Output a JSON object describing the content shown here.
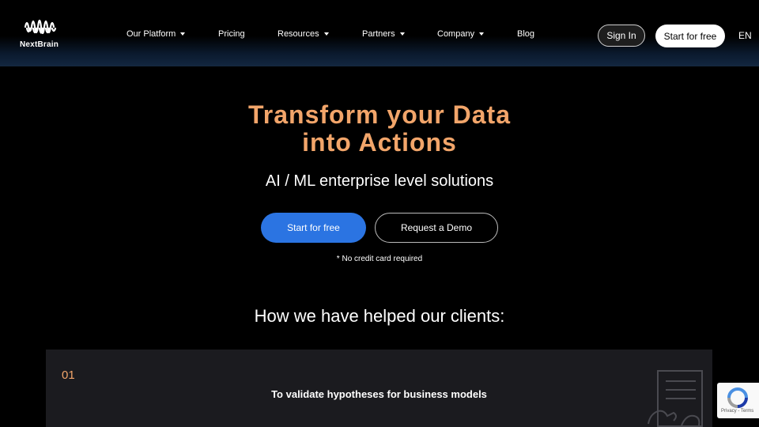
{
  "header": {
    "brand": "NextBrain",
    "nav": [
      {
        "label": "Our Platform",
        "dropdown": true
      },
      {
        "label": "Pricing",
        "dropdown": false
      },
      {
        "label": "Resources",
        "dropdown": true
      },
      {
        "label": "Partners",
        "dropdown": true
      },
      {
        "label": "Company",
        "dropdown": true
      },
      {
        "label": "Blog",
        "dropdown": false
      }
    ],
    "sign_in": "Sign In",
    "start_free": "Start for free",
    "language": "EN"
  },
  "hero": {
    "title_line1": "Transform your Data",
    "title_line2": "into Actions",
    "subtitle": "AI / ML enterprise level solutions",
    "primary_button": "Start for free",
    "secondary_button": "Request a Demo",
    "note": "* No credit card required"
  },
  "clients": {
    "title": "How we have helped our clients:",
    "card": {
      "number": "01",
      "text": "To validate hypotheses for business models"
    }
  },
  "recaptcha": {
    "links": "Privacy - Terms"
  },
  "colors": {
    "accent": "#f2a56a",
    "primary_button": "#2b74e2",
    "background": "#000000",
    "card_background": "#1b1b1f"
  }
}
